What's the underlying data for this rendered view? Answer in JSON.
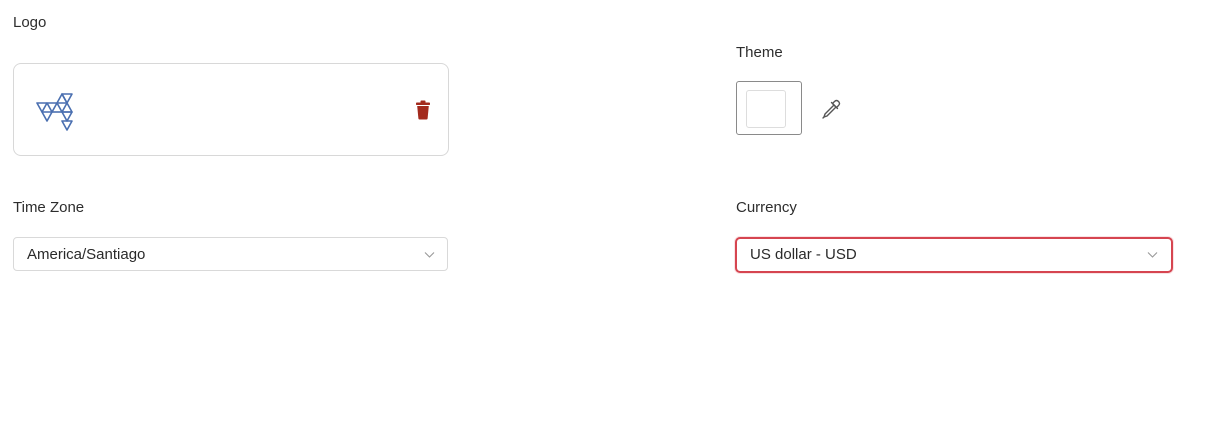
{
  "logo": {
    "label": "Logo",
    "image_icon": "triangle-logo-icon",
    "delete_icon": "trash-icon",
    "delete_color": "#a32a1d",
    "logo_color": "#4a6fb0"
  },
  "theme": {
    "label": "Theme",
    "swatch_color": "#ffffff",
    "picker_icon": "eyedropper-icon"
  },
  "timezone": {
    "label": "Time Zone",
    "value": "America/Santiago",
    "chevron_icon": "chevron-down-icon"
  },
  "currency": {
    "label": "Currency",
    "value": "US dollar - USD",
    "chevron_icon": "chevron-down-icon",
    "highlight_color": "#d64550"
  }
}
